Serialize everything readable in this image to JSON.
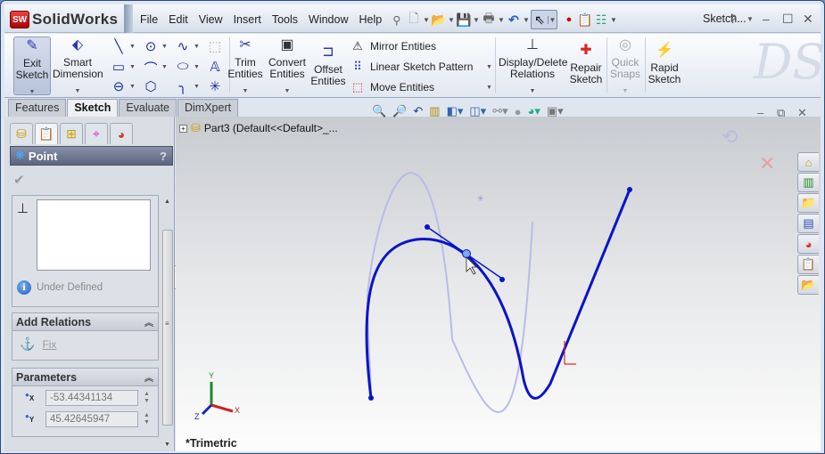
{
  "app": {
    "name": "SolidWorks",
    "badge": "SW",
    "title": "Sketch..."
  },
  "menu": [
    "File",
    "Edit",
    "View",
    "Insert",
    "Tools",
    "Window",
    "Help"
  ],
  "quick_access": [
    "new-document-icon",
    "open-icon",
    "save-icon",
    "print-icon",
    "undo-icon",
    "select-icon",
    "rebuild-icon",
    "file-properties-icon",
    "options-icon"
  ],
  "window_controls": {
    "help": "?",
    "minimize": "‒",
    "restore": "☐",
    "close": "✕"
  },
  "ribbon": {
    "exit_sketch": "Exit Sketch",
    "smart_dimension": "Smart Dimension",
    "trim_entities": "Trim Entities",
    "convert_entities": "Convert Entities",
    "offset_entities": "Offset Entities",
    "mirror_entities": "Mirror Entities",
    "linear_sketch_pattern": "Linear Sketch Pattern",
    "move_entities": "Move Entities",
    "display_delete_relations": "Display/Delete Relations",
    "repair_sketch": "Repair Sketch",
    "quick_snaps": "Quick Snaps",
    "rapid_sketch": "Rapid Sketch"
  },
  "command_tabs": [
    "Features",
    "Sketch",
    "Evaluate",
    "DimXpert"
  ],
  "active_tab": "Sketch",
  "property_manager": {
    "title": "Point",
    "help": "?",
    "status": "Under Defined",
    "add_relations": {
      "title": "Add Relations",
      "items": [
        "Fix"
      ]
    },
    "parameters": {
      "title": "Parameters",
      "x_label": "X",
      "y_label": "Y",
      "x_value": "-53.44341134",
      "y_value": "45.42645947"
    }
  },
  "viewport": {
    "tree_item": "Part3  (Default<<Default>_...",
    "view_name": "*Trimetric",
    "triad": {
      "x": "X",
      "y": "Y",
      "z": "Z"
    }
  },
  "colors": {
    "sketch_blue": "#0a14c8",
    "ghost_curve": "#b4b8e6",
    "accent_red": "#e02020"
  }
}
